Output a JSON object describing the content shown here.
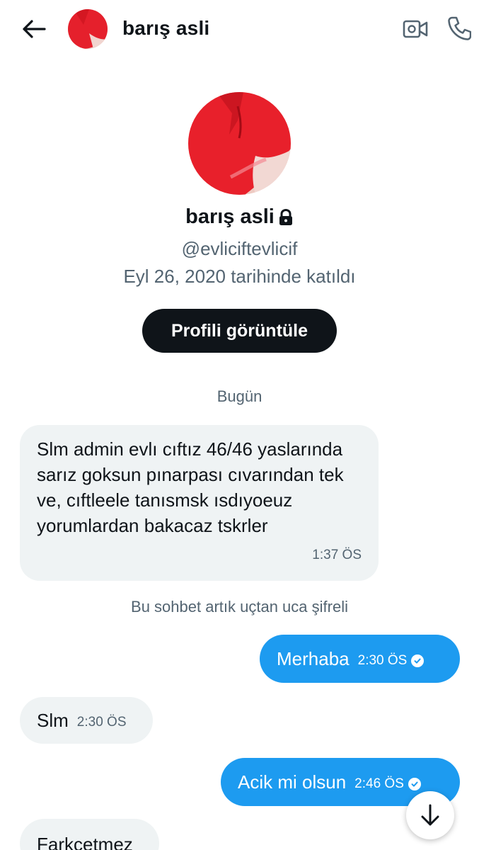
{
  "header": {
    "contact_name": "barış asli",
    "back_icon": "arrow-left-icon",
    "video_icon": "video-camera-icon",
    "call_icon": "phone-icon"
  },
  "profile": {
    "name": "barış asli",
    "lock_icon": "lock-icon",
    "handle": "@evliciftevlicif",
    "joined": "Eyl 26, 2020 tarihinde katıldı",
    "view_button": "Profili görüntüle"
  },
  "conversation": {
    "date_separator": "Bugün",
    "encryption_note": "Bu sohbet artık uçtan uca şifreli",
    "messages": [
      {
        "direction": "incoming",
        "text": "Slm admin evlı cıftız 46/46 yaslarında sarız goksun pınarpası cıvarından tek ve, cıftleele tanısmsk ısdıyoeuz yorumlardan bakacaz tskrler",
        "time": "1:37 ÖS"
      },
      {
        "direction": "outgoing",
        "text": "Merhaba",
        "time": "2:30 ÖS"
      },
      {
        "direction": "incoming",
        "text": "Slm",
        "time": "2:30 ÖS"
      },
      {
        "direction": "outgoing",
        "text": "Acik mi olsun",
        "time": "2:46 ÖS"
      },
      {
        "direction": "incoming",
        "text": "Farkcetmez",
        "time": ""
      }
    ]
  },
  "colors": {
    "accent": "#1d9bf0",
    "incoming_bubble": "#eff3f4",
    "secondary_text": "#536471",
    "primary_text": "#0f1419"
  },
  "scroll_down_icon": "arrow-down-icon"
}
